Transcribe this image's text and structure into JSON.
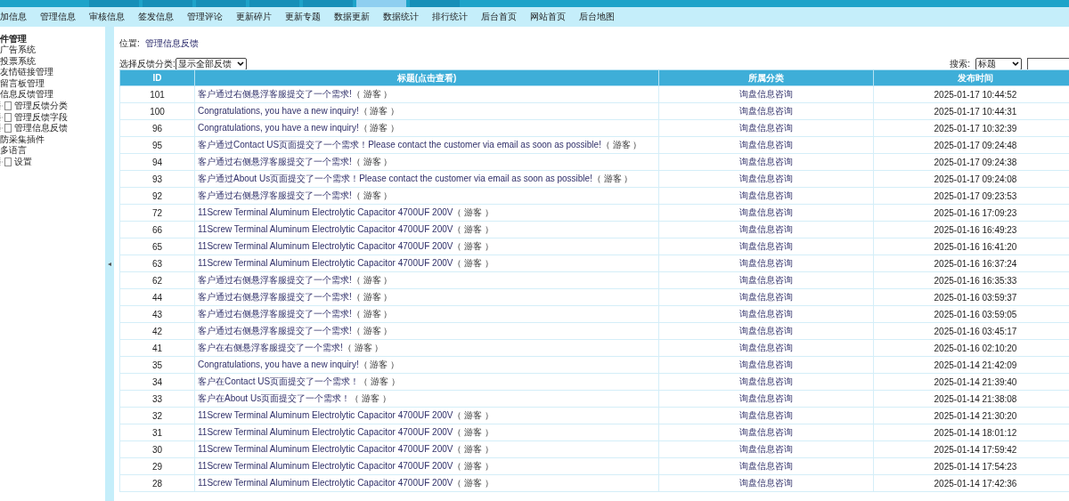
{
  "top_tabs": [
    {
      "selected": false
    },
    {
      "selected": false
    },
    {
      "selected": false
    },
    {
      "selected": false
    },
    {
      "selected": false
    },
    {
      "selected": true
    },
    {
      "selected": false
    }
  ],
  "menu": [
    "加信息",
    "管理信息",
    "审核信息",
    "签发信息",
    "管理评论",
    "更新碎片",
    "更新专题",
    "数据更新",
    "数据统计",
    "排行统计",
    "后台首页",
    "网站首页",
    "后台地图"
  ],
  "sidebar": {
    "title": "件管理",
    "items": [
      {
        "label": "广告系统"
      },
      {
        "label": "投票系统"
      },
      {
        "label": "友情链接管理"
      },
      {
        "label": "留言板管理"
      },
      {
        "label": "信息反馈管理",
        "children": [
          {
            "label": "管理反馈分类"
          },
          {
            "label": "管理反馈字段"
          },
          {
            "label": "管理信息反馈"
          }
        ]
      },
      {
        "label": "防采集插件"
      },
      {
        "label": "多语言",
        "children": [
          {
            "label": "设置"
          }
        ]
      }
    ]
  },
  "splitter_arrow": "◂",
  "breadcrumb": {
    "label": "位置:",
    "link": "管理信息反馈"
  },
  "filter": {
    "label": "选择反馈分类:",
    "value": "显示全部反馈"
  },
  "search": {
    "label": "搜索:",
    "field": "标题"
  },
  "table": {
    "columns": [
      "ID",
      "标题(点击查看)",
      "所属分类",
      "发布时间"
    ],
    "rows": [
      {
        "id": "101",
        "title": "客户通过右侧悬浮客服提交了一个需求!",
        "author": "（ 游客 ）",
        "category": "询盘信息咨询",
        "time": "2025-01-17 10:44:52"
      },
      {
        "id": "100",
        "title": "Congratulations, you have a new inquiry!",
        "author": "（ 游客 ）",
        "category": "询盘信息咨询",
        "time": "2025-01-17 10:44:31"
      },
      {
        "id": "96",
        "title": "Congratulations, you have a new inquiry!",
        "author": "（ 游客 ）",
        "category": "询盘信息咨询",
        "time": "2025-01-17 10:32:39"
      },
      {
        "id": "95",
        "title": "客户通过Contact US页面提交了一个需求！Please contact the customer via email as soon as possible!",
        "author": "（ 游客 ）",
        "category": "询盘信息咨询",
        "time": "2025-01-17 09:24:48"
      },
      {
        "id": "94",
        "title": "客户通过右侧悬浮客服提交了一个需求!",
        "author": "（ 游客 ）",
        "category": "询盘信息咨询",
        "time": "2025-01-17 09:24:38"
      },
      {
        "id": "93",
        "title": "客户通过About Us页面提交了一个需求！Please contact the customer via email as soon as possible!",
        "author": "（ 游客 ）",
        "category": "询盘信息咨询",
        "time": "2025-01-17 09:24:08"
      },
      {
        "id": "92",
        "title": "客户通过右侧悬浮客服提交了一个需求!",
        "author": "（ 游客 ）",
        "category": "询盘信息咨询",
        "time": "2025-01-17 09:23:53"
      },
      {
        "id": "72",
        "title": "11Screw Terminal Aluminum Electrolytic Capacitor 4700UF 200V",
        "author": "（ 游客 ）",
        "category": "询盘信息咨询",
        "time": "2025-01-16 17:09:23"
      },
      {
        "id": "66",
        "title": "11Screw Terminal Aluminum Electrolytic Capacitor 4700UF 200V",
        "author": "（ 游客 ）",
        "category": "询盘信息咨询",
        "time": "2025-01-16 16:49:23"
      },
      {
        "id": "65",
        "title": "11Screw Terminal Aluminum Electrolytic Capacitor 4700UF 200V",
        "author": "（ 游客 ）",
        "category": "询盘信息咨询",
        "time": "2025-01-16 16:41:20"
      },
      {
        "id": "63",
        "title": "11Screw Terminal Aluminum Electrolytic Capacitor 4700UF 200V",
        "author": "（ 游客 ）",
        "category": "询盘信息咨询",
        "time": "2025-01-16 16:37:24"
      },
      {
        "id": "62",
        "title": "客户通过右侧悬浮客服提交了一个需求!",
        "author": "（ 游客 ）",
        "category": "询盘信息咨询",
        "time": "2025-01-16 16:35:33"
      },
      {
        "id": "44",
        "title": "客户通过右侧悬浮客服提交了一个需求!",
        "author": "（ 游客 ）",
        "category": "询盘信息咨询",
        "time": "2025-01-16 03:59:37"
      },
      {
        "id": "43",
        "title": "客户通过右侧悬浮客服提交了一个需求!",
        "author": "（ 游客 ）",
        "category": "询盘信息咨询",
        "time": "2025-01-16 03:59:05"
      },
      {
        "id": "42",
        "title": "客户通过右侧悬浮客服提交了一个需求!",
        "author": "（ 游客 ）",
        "category": "询盘信息咨询",
        "time": "2025-01-16 03:45:17"
      },
      {
        "id": "41",
        "title": "客户在右侧悬浮客服提交了一个需求!",
        "author": "（ 游客 ）",
        "category": "询盘信息咨询",
        "time": "2025-01-16 02:10:20"
      },
      {
        "id": "35",
        "title": "Congratulations, you have a new inquiry!",
        "author": "（ 游客 ）",
        "category": "询盘信息咨询",
        "time": "2025-01-14 21:42:09"
      },
      {
        "id": "34",
        "title": "客户在Contact US页面提交了一个需求！",
        "author": "（ 游客 ）",
        "category": "询盘信息咨询",
        "time": "2025-01-14 21:39:40"
      },
      {
        "id": "33",
        "title": "客户在About Us页面提交了一个需求！",
        "author": "（ 游客 ）",
        "category": "询盘信息咨询",
        "time": "2025-01-14 21:38:08"
      },
      {
        "id": "32",
        "title": "11Screw Terminal Aluminum Electrolytic Capacitor 4700UF 200V",
        "author": "（ 游客 ）",
        "category": "询盘信息咨询",
        "time": "2025-01-14 21:30:20"
      },
      {
        "id": "31",
        "title": "11Screw Terminal Aluminum Electrolytic Capacitor 4700UF 200V",
        "author": "（ 游客 ）",
        "category": "询盘信息咨询",
        "time": "2025-01-14 18:01:12"
      },
      {
        "id": "30",
        "title": "11Screw Terminal Aluminum Electrolytic Capacitor 4700UF 200V",
        "author": "（ 游客 ）",
        "category": "询盘信息咨询",
        "time": "2025-01-14 17:59:42"
      },
      {
        "id": "29",
        "title": "11Screw Terminal Aluminum Electrolytic Capacitor 4700UF 200V",
        "author": "（ 游客 ）",
        "category": "询盘信息咨询",
        "time": "2025-01-14 17:54:23"
      },
      {
        "id": "28",
        "title": "11Screw Terminal Aluminum Electrolytic Capacitor 4700UF 200V",
        "author": "（ 游客 ）",
        "category": "询盘信息咨询",
        "time": "2025-01-14 17:42:36"
      }
    ]
  }
}
